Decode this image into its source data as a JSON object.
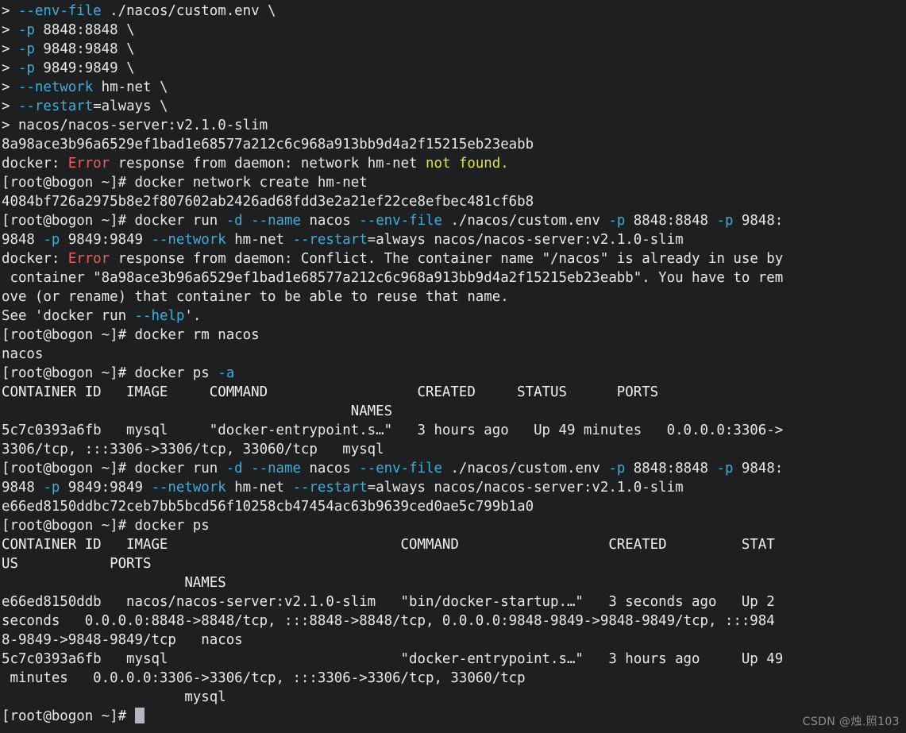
{
  "terminal": {
    "background_color": "#1d1f21",
    "foreground_color": "#e8e8e8",
    "cursor_color": "#b4b4c0",
    "palette": {
      "cyan": "#38b0de",
      "red": "#f05a5a",
      "yellow": "#e3e33c",
      "white": "#f2f2f2"
    },
    "prompt": "[root@bogon ~]# ",
    "continuation_prompt": "> ",
    "hostname": "bogon",
    "user": "root",
    "cwd_symbol": "~"
  },
  "watermark": {
    "text": "CSDN @烛.照103"
  },
  "lines": [
    {
      "id": "l1",
      "segments": [
        {
          "text": "> ",
          "color": "default"
        },
        {
          "text": "--env-file",
          "color": "cyan"
        },
        {
          "text": " ./nacos/custom.env \\",
          "color": "default"
        }
      ]
    },
    {
      "id": "l2",
      "segments": [
        {
          "text": "> ",
          "color": "default"
        },
        {
          "text": "-p",
          "color": "cyan"
        },
        {
          "text": " 8848:8848 \\",
          "color": "default"
        }
      ]
    },
    {
      "id": "l3",
      "segments": [
        {
          "text": "> ",
          "color": "default"
        },
        {
          "text": "-p",
          "color": "cyan"
        },
        {
          "text": " 9848:9848 \\",
          "color": "default"
        }
      ]
    },
    {
      "id": "l4",
      "segments": [
        {
          "text": "> ",
          "color": "default"
        },
        {
          "text": "-p",
          "color": "cyan"
        },
        {
          "text": " 9849:9849 \\",
          "color": "default"
        }
      ]
    },
    {
      "id": "l5",
      "segments": [
        {
          "text": "> ",
          "color": "default"
        },
        {
          "text": "--network",
          "color": "cyan"
        },
        {
          "text": " hm-net \\",
          "color": "default"
        }
      ]
    },
    {
      "id": "l6",
      "segments": [
        {
          "text": "> ",
          "color": "default"
        },
        {
          "text": "--restart",
          "color": "cyan"
        },
        {
          "text": "=always \\",
          "color": "default"
        }
      ]
    },
    {
      "id": "l7",
      "segments": [
        {
          "text": "> nacos/nacos-server:v2.1.0-slim",
          "color": "default"
        }
      ]
    },
    {
      "id": "l8",
      "segments": [
        {
          "text": "8a98ace3b96a6529ef1bad1e68577a212c6c968a913bb9d4a2f15215eb23eabb",
          "color": "default"
        }
      ]
    },
    {
      "id": "l9",
      "segments": [
        {
          "text": "docker: ",
          "color": "default"
        },
        {
          "text": "Error",
          "color": "red"
        },
        {
          "text": " response from daemon: network hm-net ",
          "color": "default"
        },
        {
          "text": "not found",
          "color": "yellow"
        },
        {
          "text": ".",
          "color": "yellow"
        }
      ]
    },
    {
      "id": "l10",
      "segments": [
        {
          "text": "[root@bogon ~]# docker network create hm-net",
          "color": "default"
        }
      ]
    },
    {
      "id": "l11",
      "segments": [
        {
          "text": "4084bf726a2975b8e2f807602ab2426ad68fdd3e2a21ef22ce8efbec481cf6b8",
          "color": "default"
        }
      ]
    },
    {
      "id": "l12",
      "segments": [
        {
          "text": "[root@bogon ~]# docker run ",
          "color": "default"
        },
        {
          "text": "-d",
          "color": "cyan"
        },
        {
          "text": " ",
          "color": "default"
        },
        {
          "text": "--name",
          "color": "cyan"
        },
        {
          "text": " nacos ",
          "color": "default"
        },
        {
          "text": "--env-file",
          "color": "cyan"
        },
        {
          "text": " ./nacos/custom.env ",
          "color": "default"
        },
        {
          "text": "-p",
          "color": "cyan"
        },
        {
          "text": " 8848:8848 ",
          "color": "default"
        },
        {
          "text": "-p",
          "color": "cyan"
        },
        {
          "text": " 9848:",
          "color": "default"
        }
      ]
    },
    {
      "id": "l13",
      "segments": [
        {
          "text": "9848 ",
          "color": "default"
        },
        {
          "text": "-p",
          "color": "cyan"
        },
        {
          "text": " 9849:9849 ",
          "color": "default"
        },
        {
          "text": "--network",
          "color": "cyan"
        },
        {
          "text": " hm-net ",
          "color": "default"
        },
        {
          "text": "--restart",
          "color": "cyan"
        },
        {
          "text": "=always nacos/nacos-server:v2.1.0-slim",
          "color": "default"
        }
      ]
    },
    {
      "id": "l14",
      "segments": [
        {
          "text": "docker: ",
          "color": "default"
        },
        {
          "text": "Error",
          "color": "red"
        },
        {
          "text": " response from daemon: Conflict. The container name \"/nacos\" is already in use by",
          "color": "default"
        }
      ]
    },
    {
      "id": "l15",
      "segments": [
        {
          "text": " container \"8a98ace3b96a6529ef1bad1e68577a212c6c968a913bb9d4a2f15215eb23eabb\". You have to rem",
          "color": "default"
        }
      ]
    },
    {
      "id": "l16",
      "segments": [
        {
          "text": "ove (or rename) that container to be able to reuse that name.",
          "color": "default"
        }
      ]
    },
    {
      "id": "l17",
      "segments": [
        {
          "text": "See 'docker run ",
          "color": "default"
        },
        {
          "text": "--help",
          "color": "cyan"
        },
        {
          "text": "'.",
          "color": "default"
        }
      ]
    },
    {
      "id": "l18",
      "segments": [
        {
          "text": "[root@bogon ~]# docker rm nacos",
          "color": "default"
        }
      ]
    },
    {
      "id": "l19",
      "segments": [
        {
          "text": "nacos",
          "color": "default"
        }
      ]
    },
    {
      "id": "l20",
      "segments": [
        {
          "text": "[root@bogon ~]# docker ps ",
          "color": "default"
        },
        {
          "text": "-a",
          "color": "cyan"
        }
      ]
    },
    {
      "id": "l21",
      "segments": [
        {
          "text": "CONTAINER ID   IMAGE     COMMAND                  CREATED     STATUS      PORTS",
          "color": "white"
        }
      ]
    },
    {
      "id": "l22",
      "segments": [
        {
          "text": "                                          NAMES",
          "color": "white"
        }
      ]
    },
    {
      "id": "l23",
      "segments": [
        {
          "text": "5c7c0393a6fb   mysql     \"docker-entrypoint.s…\"   3 hours ago   Up 49 minutes   0.0.0.0:3306->",
          "color": "default"
        }
      ]
    },
    {
      "id": "l24",
      "segments": [
        {
          "text": "3306/tcp, :::3306->3306/tcp, 33060/tcp   mysql",
          "color": "default"
        }
      ]
    },
    {
      "id": "l25",
      "segments": [
        {
          "text": "[root@bogon ~]# docker run ",
          "color": "default"
        },
        {
          "text": "-d",
          "color": "cyan"
        },
        {
          "text": " ",
          "color": "default"
        },
        {
          "text": "--name",
          "color": "cyan"
        },
        {
          "text": " nacos ",
          "color": "default"
        },
        {
          "text": "--env-file",
          "color": "cyan"
        },
        {
          "text": " ./nacos/custom.env ",
          "color": "default"
        },
        {
          "text": "-p",
          "color": "cyan"
        },
        {
          "text": " 8848:8848 ",
          "color": "default"
        },
        {
          "text": "-p",
          "color": "cyan"
        },
        {
          "text": " 9848:",
          "color": "default"
        }
      ]
    },
    {
      "id": "l26",
      "segments": [
        {
          "text": "9848 ",
          "color": "default"
        },
        {
          "text": "-p",
          "color": "cyan"
        },
        {
          "text": " 9849:9849 ",
          "color": "default"
        },
        {
          "text": "--network",
          "color": "cyan"
        },
        {
          "text": " hm-net ",
          "color": "default"
        },
        {
          "text": "--restart",
          "color": "cyan"
        },
        {
          "text": "=always nacos/nacos-server:v2.1.0-slim",
          "color": "default"
        }
      ]
    },
    {
      "id": "l27",
      "segments": [
        {
          "text": "e66ed8150ddbc72ceb7bb5bcd56f10258cb47454ac63b9639ced0ae5c799b1a0",
          "color": "default"
        }
      ]
    },
    {
      "id": "l28",
      "segments": [
        {
          "text": "[root@bogon ~]# docker ps",
          "color": "default"
        }
      ]
    },
    {
      "id": "l29",
      "segments": [
        {
          "text": "CONTAINER ID   IMAGE                            COMMAND                  CREATED         STAT",
          "color": "white"
        }
      ]
    },
    {
      "id": "l30",
      "segments": [
        {
          "text": "US           PORTS",
          "color": "white"
        }
      ]
    },
    {
      "id": "l31",
      "segments": [
        {
          "text": "                      NAMES",
          "color": "white"
        }
      ]
    },
    {
      "id": "l32",
      "segments": [
        {
          "text": "e66ed8150ddb   nacos/nacos-server:v2.1.0-slim   \"bin/docker-startup.…\"   3 seconds ago   Up 2",
          "color": "default"
        }
      ]
    },
    {
      "id": "l33",
      "segments": [
        {
          "text": "seconds   0.0.0.0:8848->8848/tcp, :::8848->8848/tcp, 0.0.0.0:9848-9849->9848-9849/tcp, :::984",
          "color": "default"
        }
      ]
    },
    {
      "id": "l34",
      "segments": [
        {
          "text": "8-9849->9848-9849/tcp   nacos",
          "color": "default"
        }
      ]
    },
    {
      "id": "l35",
      "segments": [
        {
          "text": "5c7c0393a6fb   mysql                            \"docker-entrypoint.s…\"   3 hours ago     Up 49",
          "color": "default"
        }
      ]
    },
    {
      "id": "l36",
      "segments": [
        {
          "text": " minutes   0.0.0.0:3306->3306/tcp, :::3306->3306/tcp, 33060/tcp",
          "color": "default"
        }
      ]
    },
    {
      "id": "l37",
      "segments": [
        {
          "text": "                      mysql",
          "color": "default"
        }
      ]
    },
    {
      "id": "l38",
      "segments": [
        {
          "text": "[root@bogon ~]# ",
          "color": "default"
        }
      ],
      "cursor": true
    }
  ]
}
